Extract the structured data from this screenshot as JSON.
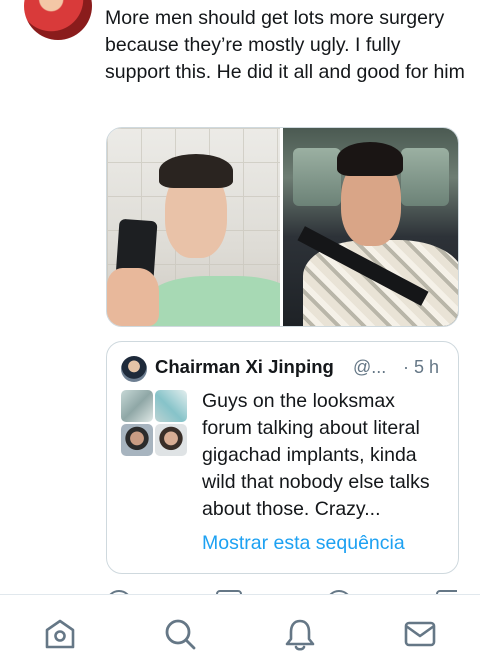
{
  "tweet": {
    "text": "More men should get lots more surgery because they’re mostly ugly. I fully support this. He did it all and good for him"
  },
  "quote": {
    "name": "Chairman Xi Jinping",
    "handle": "@...",
    "time": "· 5 h",
    "text": "Guys on the looksmax forum talking about literal gigachad implants, kinda wild that nobody else talks about those. Crazy...",
    "thread_link": "Mostrar esta sequência"
  },
  "bottom_nav": {
    "items": [
      {
        "icon": "home-icon"
      },
      {
        "icon": "search-icon"
      },
      {
        "icon": "notifications-bell-icon"
      },
      {
        "icon": "messages-envelope-icon"
      }
    ]
  },
  "colors": {
    "link": "#1da1f2",
    "text": "#14171a",
    "secondary": "#657786",
    "border": "#cfd9de"
  }
}
